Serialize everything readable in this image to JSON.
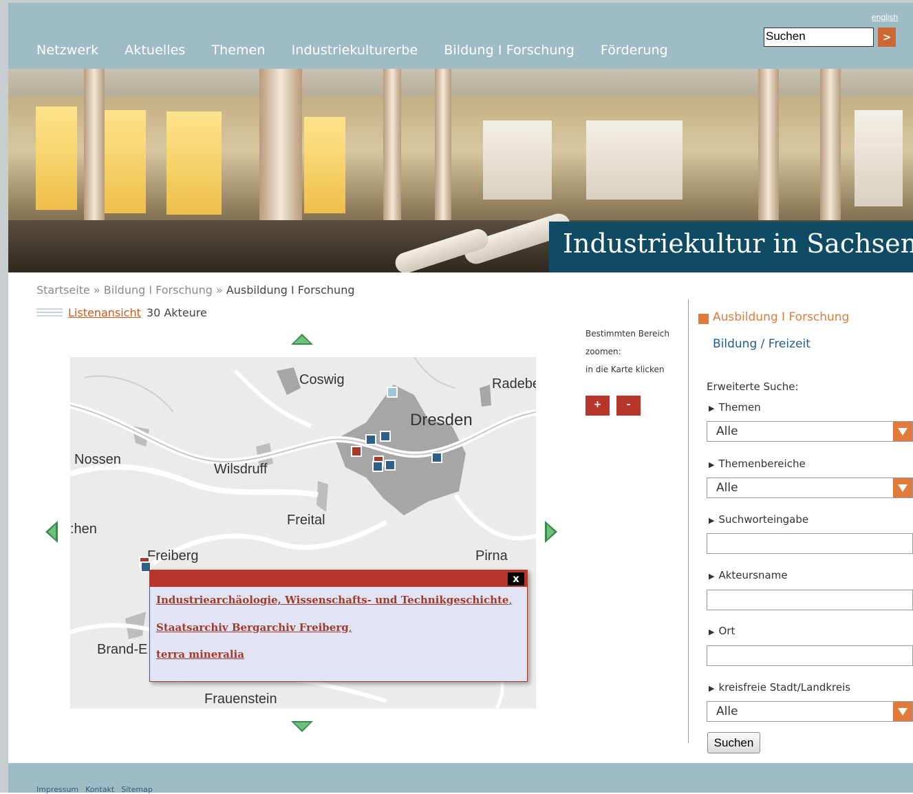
{
  "header": {
    "language_link": "english",
    "search_value": "Suchen",
    "search_go": ">",
    "nav": [
      "Netzwerk",
      "Aktuelles",
      "Themen",
      "Industriekulturerbe",
      "Bildung I Forschung",
      "Förderung"
    ]
  },
  "hero": {
    "title": "Industriekultur in Sachsen"
  },
  "breadcrumb": {
    "home": "Startseite",
    "sep": " » ",
    "parent": "Bildung I Forschung",
    "current": "Ausbildung I Forschung"
  },
  "list_view": {
    "link": "Listenansicht",
    "count": "30 Akteure"
  },
  "map": {
    "labels": {
      "coswig": "Coswig",
      "radebeul": "Radebe",
      "dresden": "Dresden",
      "nossen": "Nossen",
      "wilsdruff": "Wilsdruff",
      "freital": "Freital",
      "chen": ":hen",
      "freiberg": "Freiberg",
      "pirna": "Pirna",
      "brand": "Brand-E",
      "frauenstein": "Frauenstein"
    },
    "popup": {
      "close": "x",
      "links": [
        "Industriearchäologie, Wissenschafts- und Technikgeschichte",
        "Staatsarchiv Bergarchiv Freiberg",
        "terra mineralia"
      ],
      "comma": ","
    }
  },
  "zoom": {
    "hint_line1": "Bestimmten Bereich",
    "hint_line2": "zoomen:",
    "hint_line3": "in die Karte klicken",
    "plus": "+",
    "minus": "-"
  },
  "sidebar": {
    "heading": "Ausbildung I Forschung",
    "subheading": "Bildung / Freizeit",
    "extended_search": "Erweiterte Suche:",
    "themen_label": "Themen",
    "themen_value": "Alle",
    "themenbereiche_label": "Themenbereiche",
    "themenbereiche_value": "Alle",
    "suchwort_label": "Suchworteingabe",
    "akteur_label": "Akteursname",
    "ort_label": "Ort",
    "kreis_label": "kreisfreie Stadt/Landkreis",
    "kreis_value": "Alle",
    "submit": "Suchen"
  },
  "footer": {
    "links": [
      "Impressum",
      "Kontakt",
      "Sitemap"
    ]
  },
  "colors": {
    "header": "#9fbcc6",
    "accent_orange": "#e07b39",
    "accent_red": "#b8352a",
    "hero_title_bg": "#0f4c63"
  }
}
